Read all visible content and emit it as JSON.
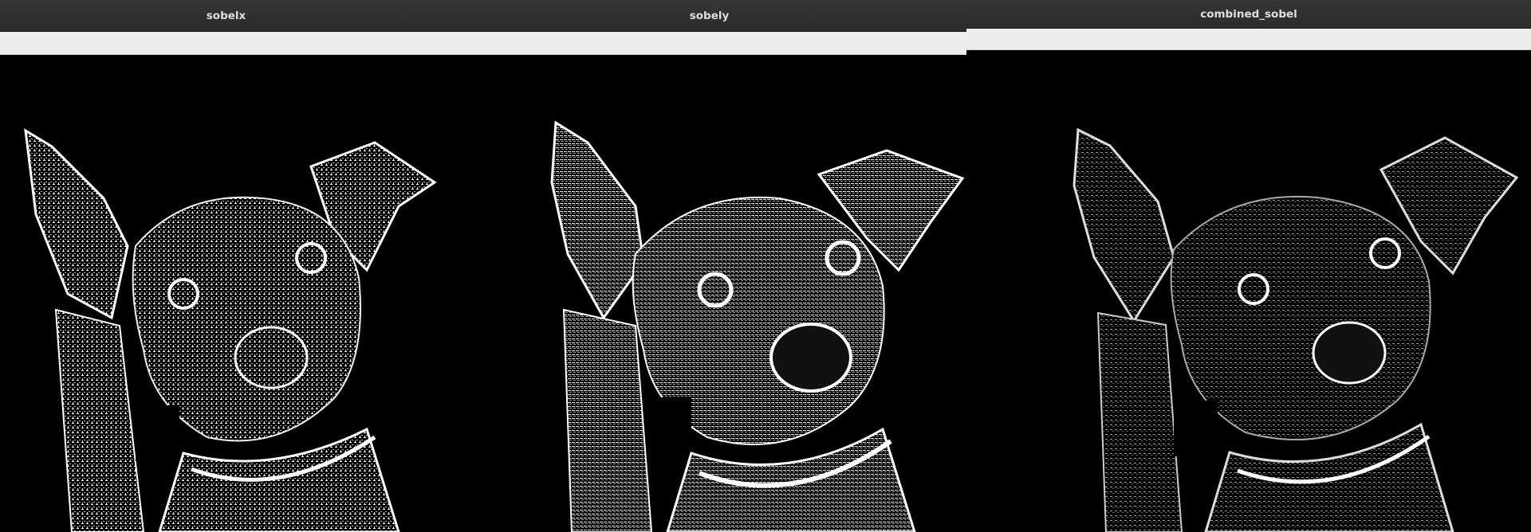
{
  "windows": [
    {
      "id": "sobelx",
      "title": "sobelx",
      "image_subject": "dog-edge-map-horizontal-gradient"
    },
    {
      "id": "sobely",
      "title": "sobely",
      "image_subject": "dog-edge-map-vertical-gradient"
    },
    {
      "id": "combined",
      "title": "combined_sobel",
      "image_subject": "dog-edge-map-combined-gradient"
    }
  ],
  "colors": {
    "titlebar": "#2f2f2f",
    "title_text": "#dedede",
    "toolbar": "#ececec",
    "canvas_bg": "#000000",
    "edge_white": "#ffffff",
    "edge_grey": "#8a8a8a"
  },
  "icons": {
    "image": "dog-edge-image"
  }
}
